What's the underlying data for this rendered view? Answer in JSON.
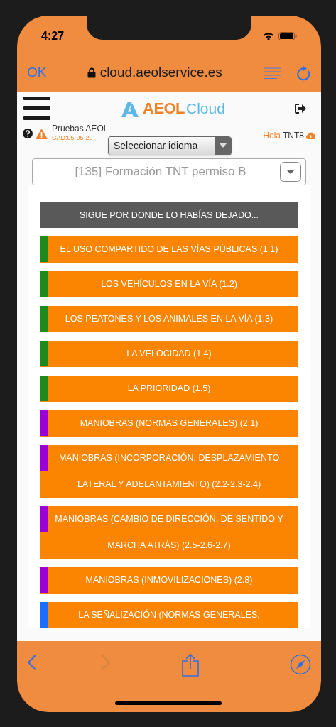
{
  "status_bar": {
    "time": "4:27"
  },
  "browser_bar": {
    "done": "OK",
    "url": "cloud.aeolservice.es"
  },
  "header": {
    "logo_primary": "AEOL",
    "logo_secondary": "Cloud"
  },
  "account": {
    "name": "Pruebas AEOL",
    "expiry": "CAD:05-05-20",
    "greeting": "Hola",
    "user": "TNT8"
  },
  "language_select": {
    "value": "Seleccionar idioma"
  },
  "course_select": {
    "value": "[135] Formación TNT permiso B"
  },
  "continue_banner": "SIGUE POR DONDE LO HABÍAS DEJADO...",
  "lessons": [
    {
      "title": "EL USO COMPARTIDO DE LAS VÍAS PÚBLICAS (1.1)",
      "color": "#1e8a1e"
    },
    {
      "title": "LOS VEHÍCULOS EN LA VÍA (1.2)",
      "color": "#1e8a1e"
    },
    {
      "title": "LOS PEATONES Y LOS ANIMALES EN LA VÍA (1.3)",
      "color": "#1e8a1e"
    },
    {
      "title": "LA VELOCIDAD (1.4)",
      "color": "#1e8a1e"
    },
    {
      "title": "LA PRIORIDAD (1.5)",
      "color": "#1e8a1e"
    },
    {
      "title": "MANIOBRAS (NORMAS GENERALES) (2.1)",
      "color": "#9b00d6"
    },
    {
      "title": "MANIOBRAS (INCORPORACIÓN, DESPLAZAMIENTO LATERAL Y ADELANTAMIENTO) (2.2-2.3-2.4)",
      "color": "#9b00d6"
    },
    {
      "title": "MANIOBRAS (CAMBIO DE DIRECCIÓN, DE SENTIDO Y MARCHA ATRÁS) (2.5-2.6-2.7)",
      "color": "#9b00d6"
    },
    {
      "title": "MANIOBRAS (INMOVILIZACIONES) (2.8)",
      "color": "#9b00d6"
    },
    {
      "title": "LA SEÑALIZACIÓN (NORMAS GENERALES,",
      "color": "#1a6dff"
    }
  ],
  "toolbar": {
    "back_disabled": false,
    "forward_disabled": true
  }
}
